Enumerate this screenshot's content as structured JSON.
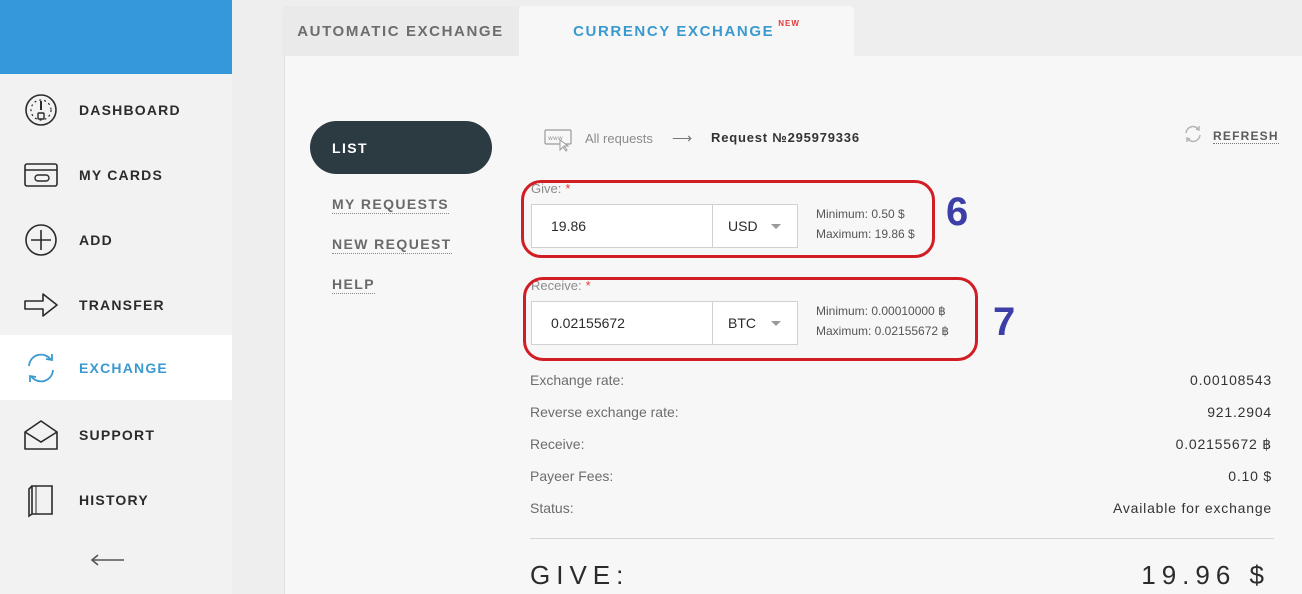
{
  "sidebar": {
    "items": [
      {
        "label": "DASHBOARD",
        "icon": "dashboard-gauge-icon"
      },
      {
        "label": "MY CARDS",
        "icon": "card-icon"
      },
      {
        "label": "ADD",
        "icon": "plus-circle-icon"
      },
      {
        "label": "TRANSFER",
        "icon": "arrow-right-icon"
      },
      {
        "label": "EXCHANGE",
        "icon": "exchange-cycle-icon",
        "active": true
      },
      {
        "label": "SUPPORT",
        "icon": "envelope-icon"
      },
      {
        "label": "HISTORY",
        "icon": "book-icon"
      }
    ],
    "collapse_icon": "arrow-left-icon",
    "brand_color": "#3498db"
  },
  "tabs": {
    "automatic": "AUTOMATIC EXCHANGE",
    "currency": "CURRENCY EXCHANGE",
    "currency_badge": "NEW"
  },
  "submenu": {
    "list": "LIST",
    "my_requests": "MY REQUESTS",
    "new_request": "NEW REQUEST",
    "help": "HELP"
  },
  "breadcrumb": {
    "all": "All requests",
    "arrow": "⟶",
    "current": "Request №295979336"
  },
  "refresh_label": "REFRESH",
  "give": {
    "label": "Give:",
    "required": "*",
    "value": "19.86",
    "currency": "USD",
    "min": "Minimum: 0.50 $",
    "max": "Maximum: 19.86 $"
  },
  "receive": {
    "label": "Receive:",
    "required": "*",
    "value": "0.02155672",
    "currency": "BTC",
    "min": "Minimum: 0.00010000 ฿",
    "max": "Maximum: 0.02155672 ฿"
  },
  "annotations": {
    "give_number": "6",
    "receive_number": "7",
    "box_color": "#d11d24",
    "number_color": "#3b3fa6"
  },
  "summary": [
    {
      "label": "Exchange rate:",
      "value": "0.00108543"
    },
    {
      "label": "Reverse exchange rate:",
      "value": "921.2904"
    },
    {
      "label": "Receive:",
      "value": "0.02155672 ฿"
    },
    {
      "label": "Payeer Fees:",
      "value": "0.10 $"
    },
    {
      "label": "Status:",
      "value": "Available for exchange"
    }
  ],
  "total": {
    "label": "GIVE:",
    "value": "19.96 $"
  }
}
